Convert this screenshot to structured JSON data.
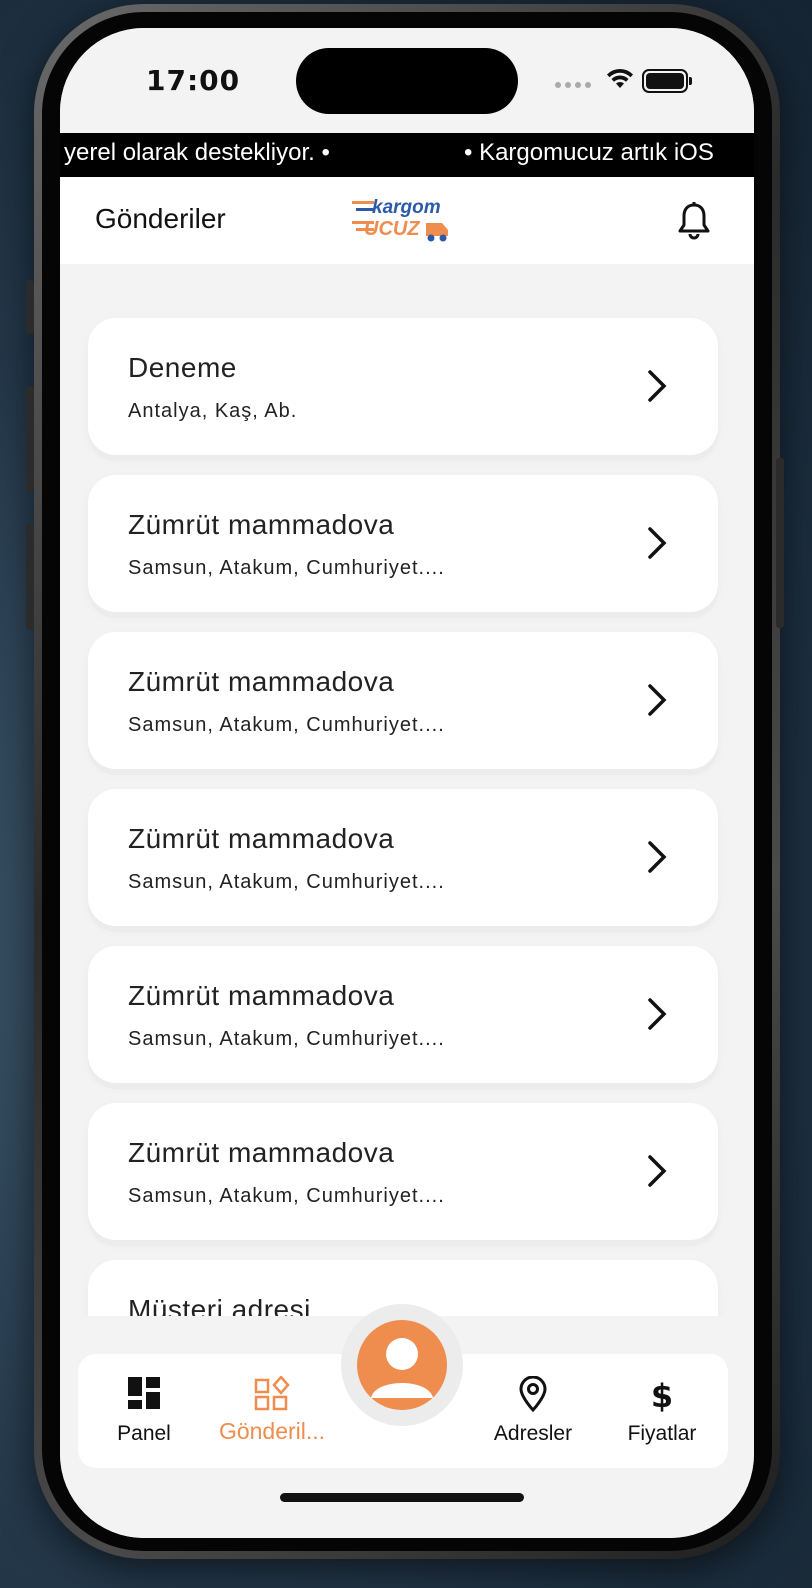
{
  "status_bar": {
    "time": "17:00"
  },
  "ticker": {
    "text_left": "yerel olarak destekliyor. •",
    "text_right": "• Kargomucuz artık iOS"
  },
  "header": {
    "title": "Gönderiler",
    "logo_text_top": "kargom",
    "logo_text_bottom": "UCUZ"
  },
  "shipments": [
    {
      "name": "Deneme",
      "address": "Antalya, Kaş, Ab."
    },
    {
      "name": "Zümrüt mammadova",
      "address": "Samsun, Atakum, Cumhuriyet...."
    },
    {
      "name": "Zümrüt mammadova",
      "address": "Samsun, Atakum, Cumhuriyet...."
    },
    {
      "name": "Zümrüt mammadova",
      "address": "Samsun, Atakum, Cumhuriyet...."
    },
    {
      "name": "Zümrüt mammadova",
      "address": "Samsun, Atakum, Cumhuriyet...."
    },
    {
      "name": "Zümrüt mammadova",
      "address": "Samsun, Atakum, Cumhuriyet...."
    },
    {
      "name": "Müşteri adresi",
      "address": ""
    }
  ],
  "bottom_nav": {
    "items": [
      {
        "label": "Panel",
        "icon": "dashboard-icon",
        "active": false
      },
      {
        "label": "Gönderil...",
        "icon": "shipments-icon",
        "active": true
      },
      {
        "label": "Adresler",
        "icon": "location-pin-icon",
        "active": false
      },
      {
        "label": "Fiyatlar",
        "icon": "dollar-icon",
        "active": false
      }
    ],
    "center_icon": "profile-icon"
  },
  "colors": {
    "accent": "#ef8d4f",
    "logo_blue": "#2b5aa8",
    "background": "#f3f3f3",
    "card": "#ffffff"
  }
}
